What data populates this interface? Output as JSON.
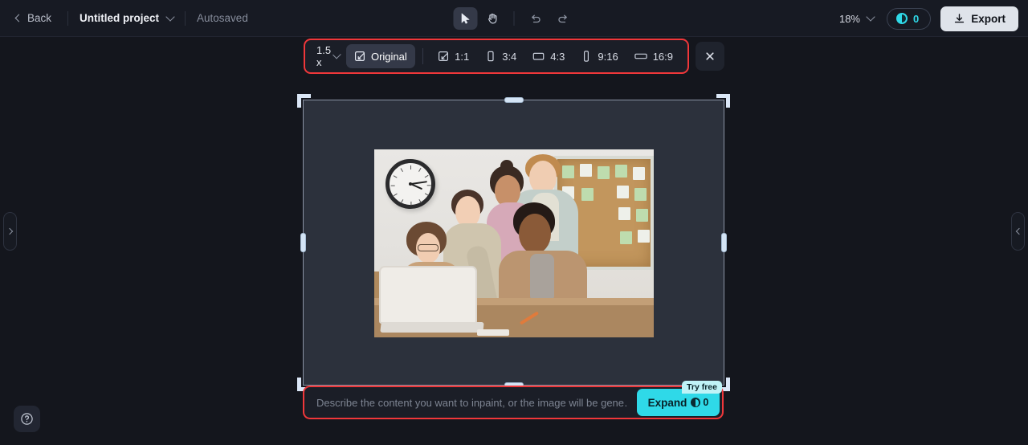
{
  "topbar": {
    "back_label": "Back",
    "project_name": "Untitled project",
    "autosaved_label": "Autosaved",
    "zoom_level": "18%",
    "credits_count": "0",
    "export_label": "Export",
    "tools": [
      {
        "name": "select-tool",
        "icon": "cursor-arrow-icon",
        "active": true
      },
      {
        "name": "hand-tool",
        "icon": "hand-icon",
        "active": false
      },
      {
        "name": "undo-tool",
        "icon": "undo-arrow-icon",
        "active": false
      },
      {
        "name": "redo-tool",
        "icon": "redo-arrow-icon",
        "active": false
      }
    ]
  },
  "ratio_toolbar": {
    "scale_value": "1.5 x",
    "items": [
      {
        "label": "Original",
        "icon": "frame-expand-icon",
        "selected": true
      },
      {
        "label": "1:1",
        "icon": "frame-expand-icon",
        "selected": false
      },
      {
        "label": "3:4",
        "icon": "portrait-rect-icon",
        "selected": false
      },
      {
        "label": "4:3",
        "icon": "landscape-rect-icon",
        "selected": false
      },
      {
        "label": "9:16",
        "icon": "tall-phone-icon",
        "selected": false
      },
      {
        "label": "16:9",
        "icon": "wide-rect-icon",
        "selected": false
      }
    ],
    "close_icon": "close-x-icon"
  },
  "canvas": {
    "image_alt": "Five smiling colleagues gathered around a laptop in an office with a wall clock and corkboard",
    "background_color": "#2c313c",
    "selection_border_color": "#8b93a4",
    "handle_color": "#dbe7f7"
  },
  "prompt": {
    "placeholder": "Describe the content you want to inpaint, or the image will be gene…",
    "value": "",
    "expand_label": "Expand",
    "expand_cost": "0",
    "badge_label": "Try free",
    "accent_color": "#2fd9e8"
  },
  "side_panels": {
    "left_toggle_icon": "chevron-right-icon",
    "right_toggle_icon": "chevron-left-icon"
  },
  "help": {
    "icon": "question-circle-icon"
  },
  "colors": {
    "app_bg": "#14161d",
    "topbar_bg": "#171a23",
    "highlight_red": "#f0373a",
    "accent_cyan": "#2fd9e8"
  }
}
